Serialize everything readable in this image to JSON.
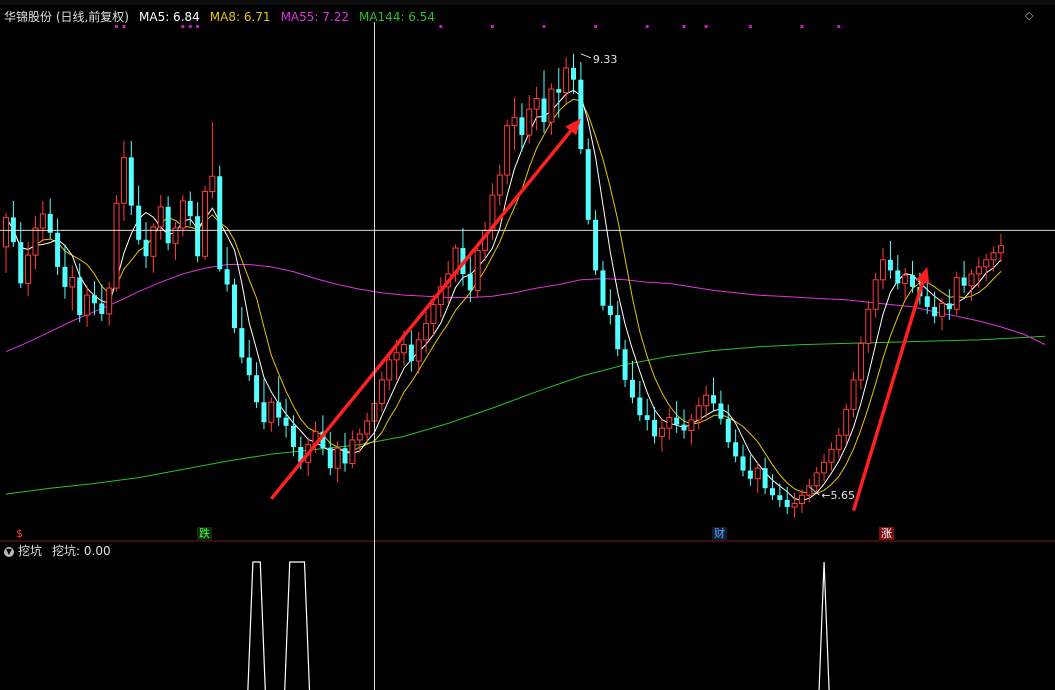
{
  "header": {
    "stock": "华锦股份 (日线,前复权)",
    "ma5": "MA5: 6.84",
    "ma8": "MA8: 6.71",
    "ma55": "MA55: 7.22",
    "ma144": "MA144: 6.54"
  },
  "sub_header": {
    "label": "挖坑",
    "value": "挖坑: 0.00"
  },
  "badges": {
    "s": "$",
    "die": "跌",
    "cai": "财",
    "zhang": "涨"
  },
  "annotations": {
    "high": "9.33",
    "low": "5.65"
  },
  "colors": {
    "up": "#ff3b3b",
    "down": "#54ffff",
    "ma5": "#ffffff",
    "ma8": "#e8c400",
    "ma55": "#e033e0",
    "ma144": "#2bbf2b",
    "dots": "#c020c0",
    "arrow": "#ff2020"
  },
  "chart_data": {
    "type": "candlestick",
    "y_unit": "price",
    "ylim": [
      5.2,
      9.6
    ],
    "x_range": [
      0,
      142
    ],
    "high_label": {
      "i": 78,
      "value": 9.33
    },
    "low_label": {
      "i": 109,
      "value": 5.65
    },
    "crosshair": {
      "i": 50,
      "price": 7.83
    },
    "candles": [
      [
        7.69,
        7.98,
        7.47,
        7.94
      ],
      [
        7.94,
        8.08,
        7.69,
        7.73
      ],
      [
        7.73,
        7.9,
        7.34,
        7.38
      ],
      [
        7.38,
        7.73,
        7.27,
        7.62
      ],
      [
        7.62,
        7.95,
        7.5,
        7.85
      ],
      [
        7.85,
        8.08,
        7.73,
        7.97
      ],
      [
        7.97,
        8.1,
        7.76,
        7.81
      ],
      [
        7.81,
        7.93,
        7.45,
        7.52
      ],
      [
        7.52,
        7.71,
        7.25,
        7.35
      ],
      [
        7.35,
        7.53,
        7.15,
        7.43
      ],
      [
        7.43,
        7.55,
        7.05,
        7.11
      ],
      [
        7.11,
        7.36,
        7.01,
        7.28
      ],
      [
        7.28,
        7.4,
        7.11,
        7.21
      ],
      [
        7.21,
        7.37,
        7.06,
        7.12
      ],
      [
        7.12,
        7.39,
        7.02,
        7.34
      ],
      [
        7.34,
        8.13,
        7.31,
        8.06
      ],
      [
        8.06,
        8.59,
        7.91,
        8.45
      ],
      [
        8.45,
        8.59,
        7.96,
        8.04
      ],
      [
        8.04,
        8.21,
        7.71,
        7.75
      ],
      [
        7.75,
        7.9,
        7.51,
        7.61
      ],
      [
        7.61,
        7.89,
        7.47,
        7.86
      ],
      [
        7.86,
        8.13,
        7.75,
        8.03
      ],
      [
        8.03,
        8.12,
        7.66,
        7.72
      ],
      [
        7.72,
        7.9,
        7.58,
        7.85
      ],
      [
        7.85,
        8.13,
        7.78,
        8.08
      ],
      [
        8.08,
        8.16,
        7.87,
        7.95
      ],
      [
        7.95,
        8.07,
        7.56,
        7.61
      ],
      [
        7.61,
        8.21,
        7.58,
        8.16
      ],
      [
        8.16,
        8.75,
        8.1,
        8.29
      ],
      [
        8.29,
        8.38,
        7.48,
        7.5
      ],
      [
        7.5,
        7.69,
        7.31,
        7.37
      ],
      [
        7.37,
        7.42,
        6.96,
        7.0
      ],
      [
        7.0,
        7.18,
        6.7,
        6.75
      ],
      [
        6.75,
        6.9,
        6.55,
        6.6
      ],
      [
        6.6,
        6.71,
        6.32,
        6.37
      ],
      [
        6.37,
        6.57,
        6.14,
        6.2
      ],
      [
        6.2,
        6.41,
        6.12,
        6.37
      ],
      [
        6.37,
        6.59,
        6.17,
        6.24
      ],
      [
        6.24,
        6.4,
        6.07,
        6.17
      ],
      [
        6.17,
        6.26,
        5.91,
        5.99
      ],
      [
        5.99,
        6.08,
        5.8,
        5.86
      ],
      [
        5.86,
        6.07,
        5.74,
        6.01
      ],
      [
        6.01,
        6.21,
        5.94,
        6.12
      ],
      [
        6.12,
        6.26,
        5.92,
        5.98
      ],
      [
        5.98,
        6.12,
        5.75,
        5.81
      ],
      [
        5.81,
        6.04,
        5.69,
        5.98
      ],
      [
        5.98,
        6.11,
        5.78,
        5.85
      ],
      [
        5.85,
        6.13,
        5.81,
        6.05
      ],
      [
        6.05,
        6.15,
        5.94,
        6.1
      ],
      [
        6.1,
        6.28,
        6.02,
        6.21
      ],
      [
        6.21,
        6.42,
        6.15,
        6.36
      ],
      [
        6.36,
        6.63,
        6.29,
        6.56
      ],
      [
        6.56,
        6.79,
        6.47,
        6.73
      ],
      [
        6.73,
        6.9,
        6.56,
        6.79
      ],
      [
        6.79,
        6.98,
        6.68,
        6.86
      ],
      [
        6.86,
        6.98,
        6.63,
        6.72
      ],
      [
        6.72,
        6.97,
        6.61,
        6.9
      ],
      [
        6.9,
        7.14,
        6.79,
        7.04
      ],
      [
        7.04,
        7.28,
        6.94,
        7.2
      ],
      [
        7.2,
        7.43,
        7.09,
        7.35
      ],
      [
        7.35,
        7.57,
        7.21,
        7.46
      ],
      [
        7.46,
        7.71,
        7.39,
        7.68
      ],
      [
        7.68,
        7.85,
        7.36,
        7.46
      ],
      [
        7.46,
        7.65,
        7.22,
        7.32
      ],
      [
        7.32,
        7.73,
        7.26,
        7.66
      ],
      [
        7.66,
        7.9,
        7.57,
        7.83
      ],
      [
        7.83,
        8.23,
        7.75,
        8.13
      ],
      [
        8.13,
        8.39,
        8.04,
        8.3
      ],
      [
        8.3,
        8.77,
        8.22,
        8.72
      ],
      [
        8.72,
        8.96,
        8.51,
        8.79
      ],
      [
        8.79,
        8.91,
        8.5,
        8.64
      ],
      [
        8.64,
        8.98,
        8.57,
        8.86
      ],
      [
        8.86,
        9.05,
        8.68,
        8.95
      ],
      [
        8.95,
        9.19,
        8.66,
        8.75
      ],
      [
        8.75,
        9.08,
        8.64,
        9.03
      ],
      [
        9.03,
        9.21,
        8.79,
        9.0
      ],
      [
        9.0,
        9.3,
        8.91,
        9.21
      ],
      [
        9.21,
        9.33,
        8.99,
        9.11
      ],
      [
        9.11,
        9.26,
        8.48,
        8.52
      ],
      [
        8.52,
        8.61,
        7.88,
        7.92
      ],
      [
        7.92,
        8.0,
        7.45,
        7.49
      ],
      [
        7.49,
        7.57,
        7.15,
        7.19
      ],
      [
        7.19,
        7.33,
        7.03,
        7.11
      ],
      [
        7.11,
        7.23,
        6.76,
        6.82
      ],
      [
        6.82,
        6.9,
        6.5,
        6.56
      ],
      [
        6.56,
        6.72,
        6.36,
        6.41
      ],
      [
        6.41,
        6.55,
        6.21,
        6.26
      ],
      [
        6.26,
        6.4,
        6.13,
        6.22
      ],
      [
        6.22,
        6.33,
        6.02,
        6.08
      ],
      [
        6.08,
        6.23,
        5.95,
        6.15
      ],
      [
        6.15,
        6.32,
        6.05,
        6.24
      ],
      [
        6.24,
        6.38,
        6.11,
        6.18
      ],
      [
        6.18,
        6.31,
        6.06,
        6.13
      ],
      [
        6.13,
        6.27,
        6.01,
        6.22
      ],
      [
        6.22,
        6.41,
        6.14,
        6.34
      ],
      [
        6.34,
        6.51,
        6.24,
        6.43
      ],
      [
        6.43,
        6.58,
        6.3,
        6.36
      ],
      [
        6.36,
        6.47,
        6.18,
        6.23
      ],
      [
        6.23,
        6.35,
        5.98,
        6.03
      ],
      [
        6.03,
        6.14,
        5.86,
        5.91
      ],
      [
        5.91,
        6.01,
        5.74,
        5.79
      ],
      [
        5.79,
        5.92,
        5.66,
        5.72
      ],
      [
        5.72,
        5.86,
        5.6,
        5.81
      ],
      [
        5.81,
        5.9,
        5.59,
        5.64
      ],
      [
        5.64,
        5.76,
        5.54,
        5.58
      ],
      [
        5.58,
        5.68,
        5.48,
        5.54
      ],
      [
        5.54,
        5.65,
        5.42,
        5.48
      ],
      [
        5.48,
        5.6,
        5.39,
        5.51
      ],
      [
        5.51,
        5.63,
        5.43,
        5.58
      ],
      [
        5.58,
        5.72,
        5.52,
        5.66
      ],
      [
        5.66,
        5.82,
        5.6,
        5.77
      ],
      [
        5.77,
        5.93,
        5.7,
        5.86
      ],
      [
        5.86,
        6.03,
        5.79,
        5.97
      ],
      [
        5.97,
        6.15,
        5.9,
        6.09
      ],
      [
        6.09,
        6.36,
        6.01,
        6.31
      ],
      [
        6.31,
        6.63,
        6.24,
        6.56
      ],
      [
        6.56,
        6.93,
        6.48,
        6.87
      ],
      [
        6.87,
        7.23,
        6.79,
        7.16
      ],
      [
        7.16,
        7.47,
        7.09,
        7.41
      ],
      [
        7.41,
        7.68,
        7.33,
        7.58
      ],
      [
        7.58,
        7.74,
        7.42,
        7.49
      ],
      [
        7.49,
        7.62,
        7.33,
        7.38
      ],
      [
        7.38,
        7.51,
        7.24,
        7.45
      ],
      [
        7.45,
        7.57,
        7.3,
        7.35
      ],
      [
        7.35,
        7.47,
        7.2,
        7.27
      ],
      [
        7.27,
        7.4,
        7.12,
        7.18
      ],
      [
        7.18,
        7.31,
        7.04,
        7.1
      ],
      [
        7.1,
        7.26,
        6.98,
        7.21
      ],
      [
        7.21,
        7.33,
        7.07,
        7.16
      ],
      [
        7.16,
        7.48,
        7.11,
        7.43
      ],
      [
        7.43,
        7.57,
        7.3,
        7.36
      ],
      [
        7.36,
        7.5,
        7.23,
        7.46
      ],
      [
        7.46,
        7.6,
        7.34,
        7.52
      ],
      [
        7.52,
        7.63,
        7.4,
        7.58
      ],
      [
        7.58,
        7.69,
        7.48,
        7.64
      ],
      [
        7.64,
        7.8,
        7.56,
        7.7
      ]
    ],
    "ma55": [
      [
        0,
        6.8
      ],
      [
        3,
        6.88
      ],
      [
        6,
        6.97
      ],
      [
        9,
        7.06
      ],
      [
        12,
        7.14
      ],
      [
        15,
        7.22
      ],
      [
        18,
        7.31
      ],
      [
        21,
        7.39
      ],
      [
        24,
        7.46
      ],
      [
        27,
        7.51
      ],
      [
        30,
        7.54
      ],
      [
        33,
        7.54
      ],
      [
        36,
        7.52
      ],
      [
        39,
        7.48
      ],
      [
        42,
        7.42
      ],
      [
        45,
        7.37
      ],
      [
        48,
        7.33
      ],
      [
        51,
        7.3
      ],
      [
        54,
        7.28
      ],
      [
        57,
        7.27
      ],
      [
        60,
        7.26
      ],
      [
        63,
        7.26
      ],
      [
        66,
        7.27
      ],
      [
        69,
        7.3
      ],
      [
        72,
        7.34
      ],
      [
        75,
        7.37
      ],
      [
        78,
        7.41
      ],
      [
        81,
        7.42
      ],
      [
        84,
        7.41
      ],
      [
        87,
        7.39
      ],
      [
        90,
        7.38
      ],
      [
        93,
        7.35
      ],
      [
        96,
        7.32
      ],
      [
        99,
        7.3
      ],
      [
        102,
        7.28
      ],
      [
        105,
        7.27
      ],
      [
        108,
        7.26
      ],
      [
        111,
        7.25
      ],
      [
        114,
        7.24
      ],
      [
        117,
        7.22
      ],
      [
        120,
        7.2
      ],
      [
        123,
        7.18
      ],
      [
        126,
        7.14
      ],
      [
        129,
        7.1
      ],
      [
        132,
        7.06
      ],
      [
        135,
        7.01
      ],
      [
        138,
        6.95
      ],
      [
        141,
        6.86
      ]
    ],
    "ma144": [
      [
        0,
        5.59
      ],
      [
        6,
        5.64
      ],
      [
        12,
        5.68
      ],
      [
        18,
        5.73
      ],
      [
        24,
        5.8
      ],
      [
        30,
        5.87
      ],
      [
        36,
        5.93
      ],
      [
        42,
        5.97
      ],
      [
        48,
        6.01
      ],
      [
        54,
        6.08
      ],
      [
        60,
        6.19
      ],
      [
        66,
        6.32
      ],
      [
        72,
        6.46
      ],
      [
        78,
        6.59
      ],
      [
        84,
        6.69
      ],
      [
        90,
        6.76
      ],
      [
        96,
        6.81
      ],
      [
        102,
        6.84
      ],
      [
        108,
        6.86
      ],
      [
        114,
        6.87
      ],
      [
        120,
        6.88
      ],
      [
        126,
        6.89
      ],
      [
        132,
        6.9
      ],
      [
        138,
        6.92
      ],
      [
        141,
        6.93
      ]
    ],
    "signal_dots": [
      15,
      16,
      24,
      25,
      26,
      59,
      66,
      73,
      80,
      87,
      92,
      95,
      101,
      108,
      113
    ],
    "arrows": [
      [
        36,
        5.55,
        78,
        8.78
      ],
      [
        115,
        5.45,
        125,
        7.52
      ]
    ],
    "sub_ylim": [
      0,
      1
    ],
    "peaks": [
      [
        33.5,
        34.5
      ],
      [
        38.5,
        40.5
      ],
      [
        111,
        111
      ]
    ]
  }
}
